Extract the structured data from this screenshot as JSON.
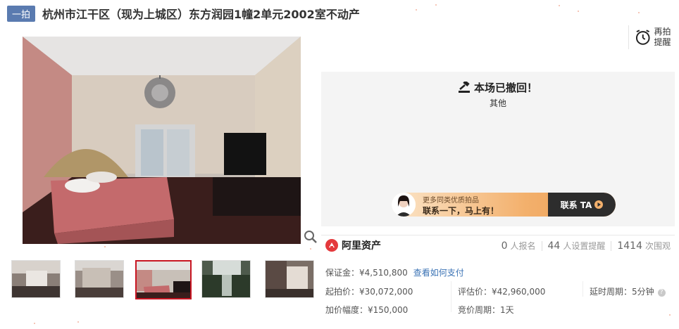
{
  "header": {
    "badge": "一拍",
    "title": "杭州市江干区（现为上城区）东方润园1幢2单元2002室不动产"
  },
  "remind": {
    "label": "再拍提醒",
    "icon": "alarm-clock-icon"
  },
  "status": {
    "headline": "本场已撤回！",
    "reason": "其他",
    "icon": "gavel-icon"
  },
  "contact_banner": {
    "line1": "更多同类优质拍品",
    "line2": "联系一下，马上有！",
    "button": "联系 TA"
  },
  "brand": {
    "name": "阿里资产",
    "color": "#e4393c"
  },
  "stats": {
    "signups_count": "0",
    "signups_label": "人报名",
    "reminders_count": "44",
    "reminders_label": "人设置提醒",
    "views_count": "1414",
    "views_label": "次围观"
  },
  "details": {
    "deposit_label": "保证金：",
    "deposit_value": "¥4,510,800",
    "deposit_link": "查看如何支付",
    "start_price_label": "起拍价：",
    "start_price_value": "¥30,072,000",
    "appraisal_label": "评估价：",
    "appraisal_value": "¥42,960,000",
    "delay_label": "延时周期：",
    "delay_value": "5分钟",
    "increment_label": "加价幅度：",
    "increment_value": "¥150,000",
    "cycle_label": "竞价周期：",
    "cycle_value": "1天"
  },
  "thumbnails": {
    "count": 5,
    "selected_index": 2
  }
}
